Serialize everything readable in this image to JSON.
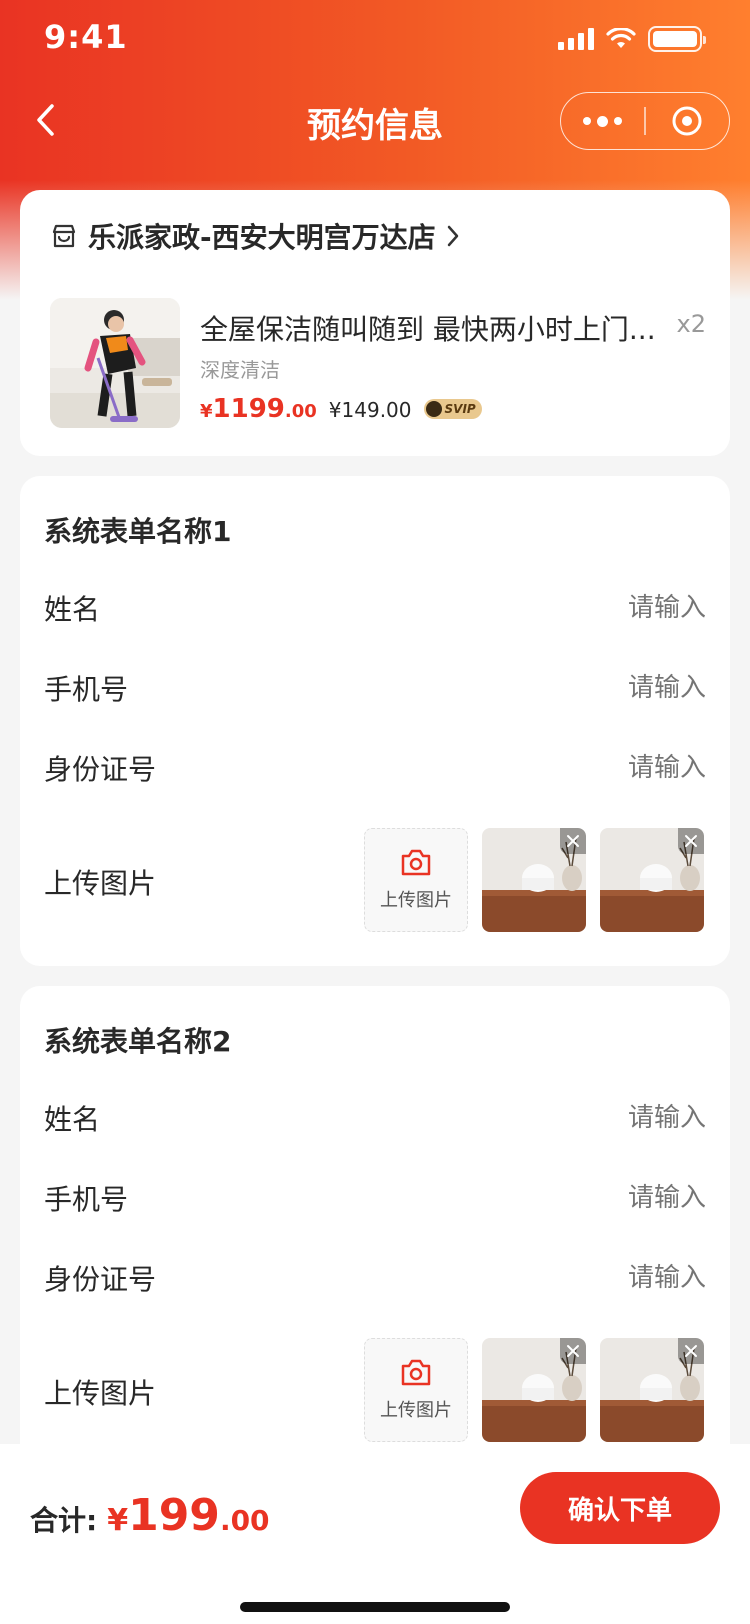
{
  "status_bar": {
    "time": "9:41"
  },
  "nav": {
    "title": "预约信息"
  },
  "order": {
    "store_name": "乐派家政-西安大明宫万达店",
    "product": {
      "name": "全屋保洁随叫随到 最快两小时上门...",
      "quantity": "x2",
      "spec": "深度清洁",
      "price_symbol": "¥",
      "price_int": "1199",
      "price_dec": ".00",
      "vip_price": "¥149.00",
      "vip_badge": "SVIP"
    }
  },
  "forms": [
    {
      "title": "系统表单名称1",
      "fields": [
        {
          "label": "姓名",
          "placeholder": "请输入"
        },
        {
          "label": "手机号",
          "placeholder": "请输入"
        },
        {
          "label": "身份证号",
          "placeholder": "请输入"
        }
      ],
      "upload_label": "上传图片",
      "upload_button_text": "上传图片"
    },
    {
      "title": "系统表单名称2",
      "fields": [
        {
          "label": "姓名",
          "placeholder": "请输入"
        },
        {
          "label": "手机号",
          "placeholder": "请输入"
        },
        {
          "label": "身份证号",
          "placeholder": "请输入"
        }
      ],
      "upload_label": "上传图片",
      "upload_button_text": "上传图片"
    }
  ],
  "footer": {
    "total_label": "合计:",
    "total_symbol": "¥",
    "total_int": "199",
    "total_dec": ".00",
    "confirm_label": "确认下单"
  },
  "theme": {
    "primary": "#e93323",
    "gradient_end": "#ff7f2e"
  },
  "icons": {
    "back": "chevron-left-icon",
    "more": "more-dots-icon",
    "target": "target-icon",
    "store": "store-icon",
    "camera": "camera-icon",
    "close": "close-icon"
  }
}
